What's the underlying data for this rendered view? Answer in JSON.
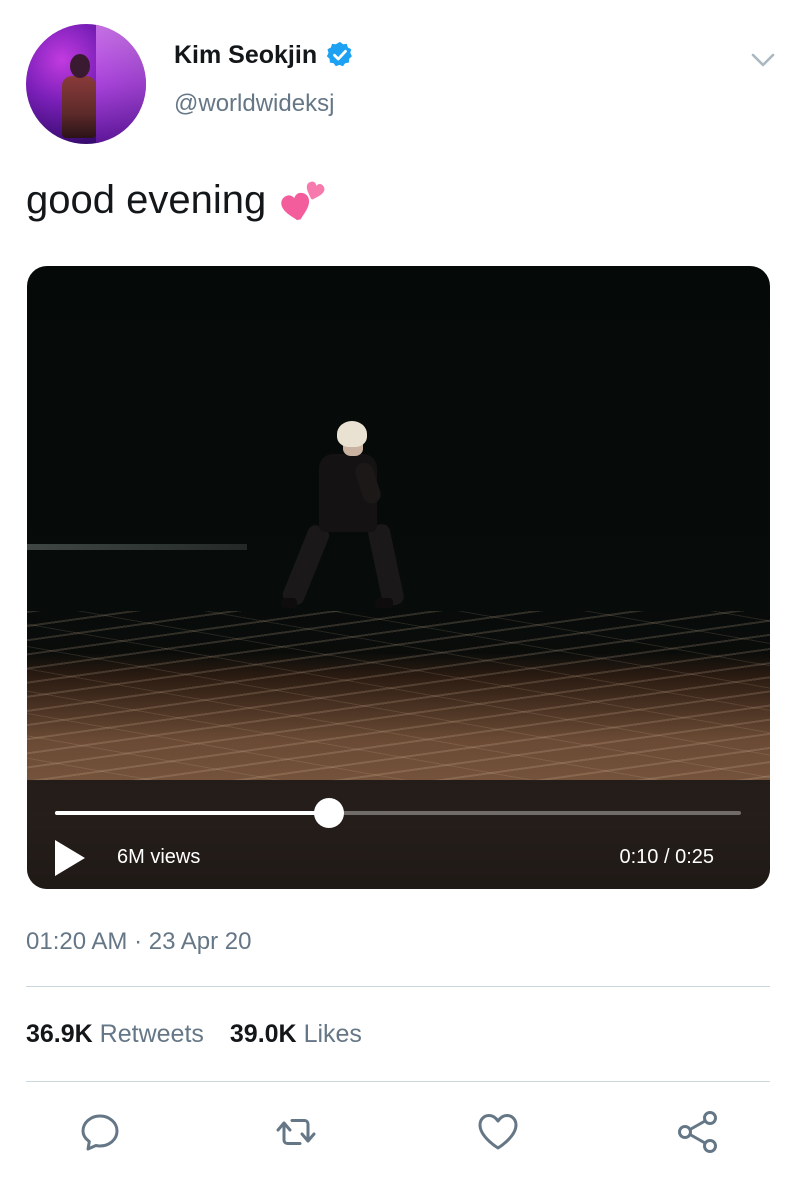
{
  "author": {
    "display_name": "Kim Seokjin",
    "handle": "@worldwideksj",
    "verified": true
  },
  "tweet": {
    "text": "good evening",
    "emoji": "two-hearts"
  },
  "video": {
    "views": "6M views",
    "time": "0:10 / 0:25",
    "progress": 0.4
  },
  "meta": {
    "timestamp": "01:20 AM · 23 Apr 20"
  },
  "stats": {
    "retweets_count": "36.9K",
    "retweets_label": "Retweets",
    "likes_count": "39.0K",
    "likes_label": "Likes"
  },
  "icons": {
    "reply": "reply-icon",
    "retweet": "retweet-icon",
    "like": "heart-icon",
    "share": "share-icon"
  },
  "colors": {
    "verified": "#1da1f2",
    "secondary_text": "#657786",
    "icon": "#657786"
  }
}
